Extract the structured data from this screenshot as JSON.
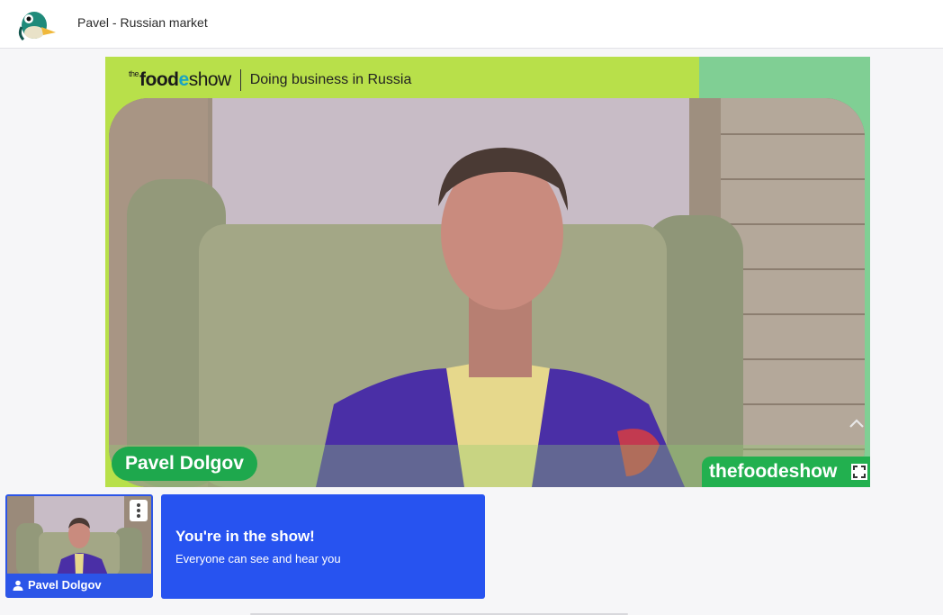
{
  "header": {
    "title": "Pavel - Russian market",
    "logo_icon": "duck-logo-icon"
  },
  "stage": {
    "brand_prefix": "the",
    "brand_food": "food",
    "brand_e": "e",
    "brand_show": "show",
    "subtitle": "Doing business in Russia",
    "presenter_name": "Pavel Dolgov",
    "brand_tag": "thefoodeshow",
    "colors": {
      "lime": "#b8e04a",
      "mint": "#80cf94",
      "green_pill": "#1ea84d"
    }
  },
  "participant": {
    "name": "Pavel Dolgov",
    "menu_icon": "kebab-menu-icon"
  },
  "banner": {
    "title": "You're in the show!",
    "subtitle": "Everyone can see and hear you",
    "color": "#2753f0"
  }
}
